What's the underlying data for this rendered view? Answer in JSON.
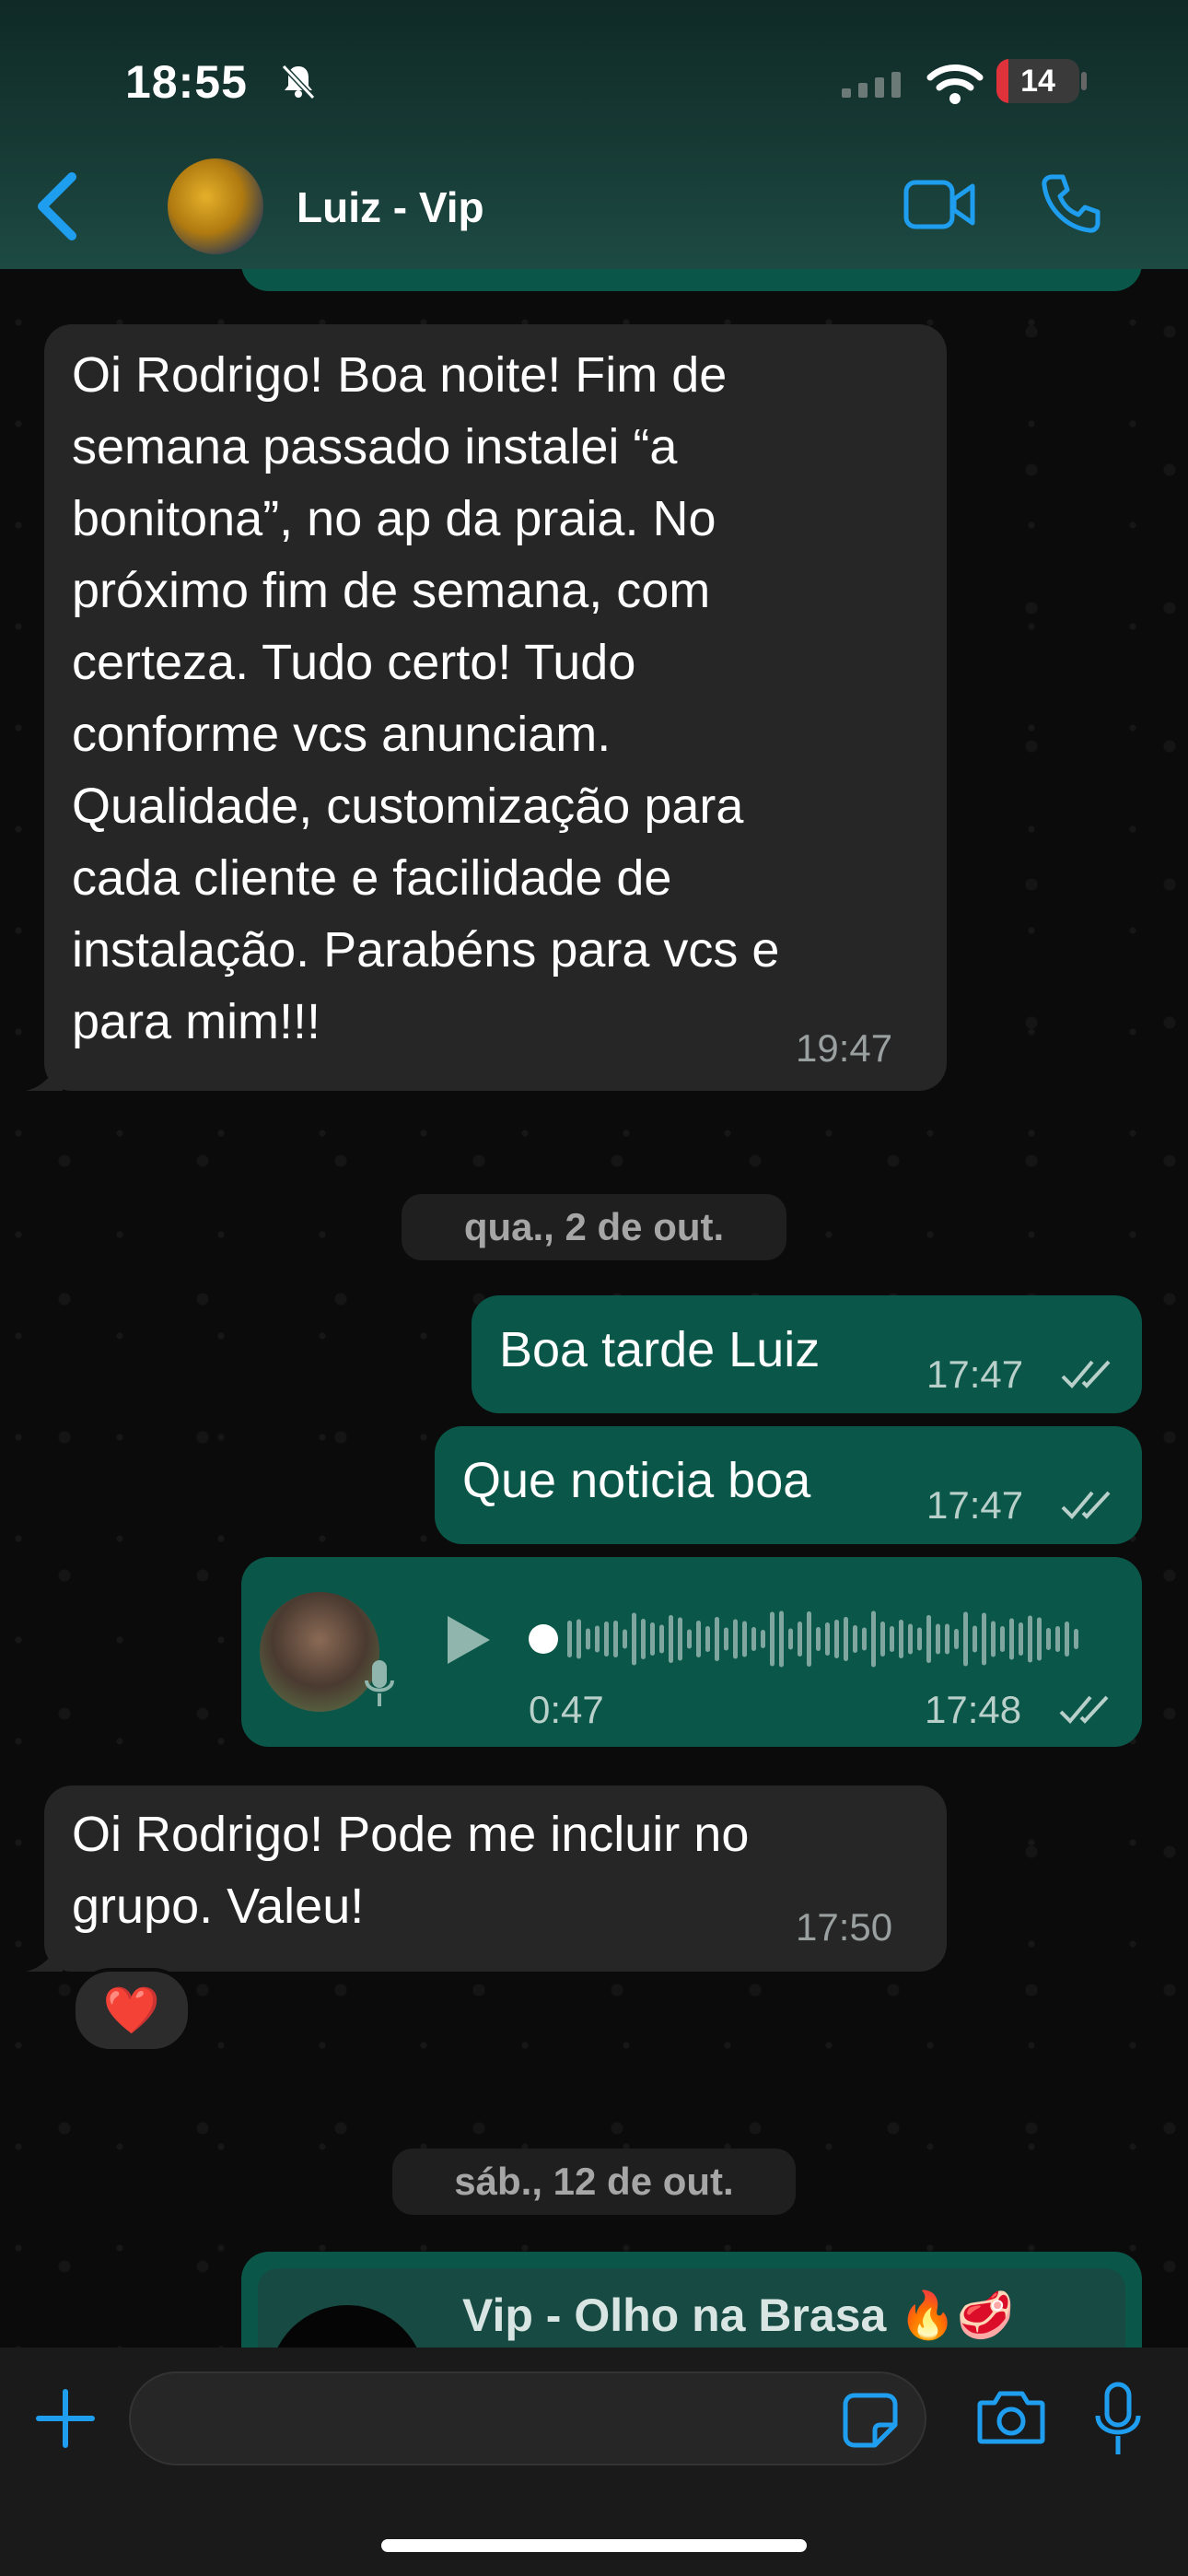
{
  "status_bar": {
    "time": "18:55",
    "battery": "14",
    "battery_fraction": 0.14
  },
  "header": {
    "contact_name": "Luiz - Vip"
  },
  "messages": [
    {
      "direction": "in",
      "text": "Oi Rodrigo! Boa noite! Fim de\nsemana passado instalei “a\nbonitona”, no ap da praia. No\npróximo fim de semana, com\ncerteza. Tudo certo! Tudo\nconforme vcs anunciam.\nQualidade, customização para\ncada cliente e facilidade de\ninstalação. Parabéns para vcs e\npara mim!!!",
      "time": "19:47"
    },
    {
      "direction": "out",
      "text": "Boa tarde Luiz",
      "time": "17:47"
    },
    {
      "direction": "out",
      "text": "Que noticia boa",
      "time": "17:47"
    },
    {
      "direction": "out",
      "type": "audio",
      "duration": "0:47",
      "time": "17:48"
    },
    {
      "direction": "in",
      "text": "Oi Rodrigo! Pode me incluir no\ngrupo. Valeu!",
      "time": "17:50",
      "reaction": "❤️"
    }
  ],
  "dates": [
    "qua., 2 de out.",
    "sáb., 12 de out."
  ],
  "group_invite": {
    "title": "Vip - Olho na Brasa 🔥🥩"
  },
  "colors": {
    "accent": "#1f9ef0",
    "bubble_out": "#0a574a",
    "bubble_in": "#262626",
    "battery_low": "#e0323b"
  },
  "icons": [
    "back-chevron-icon",
    "video-call-icon",
    "phone-icon",
    "plus-icon",
    "sticker-icon",
    "camera-icon",
    "microphone-icon",
    "play-icon",
    "double-check-icon",
    "bell-slash-icon",
    "wifi-icon",
    "signal-icon"
  ]
}
